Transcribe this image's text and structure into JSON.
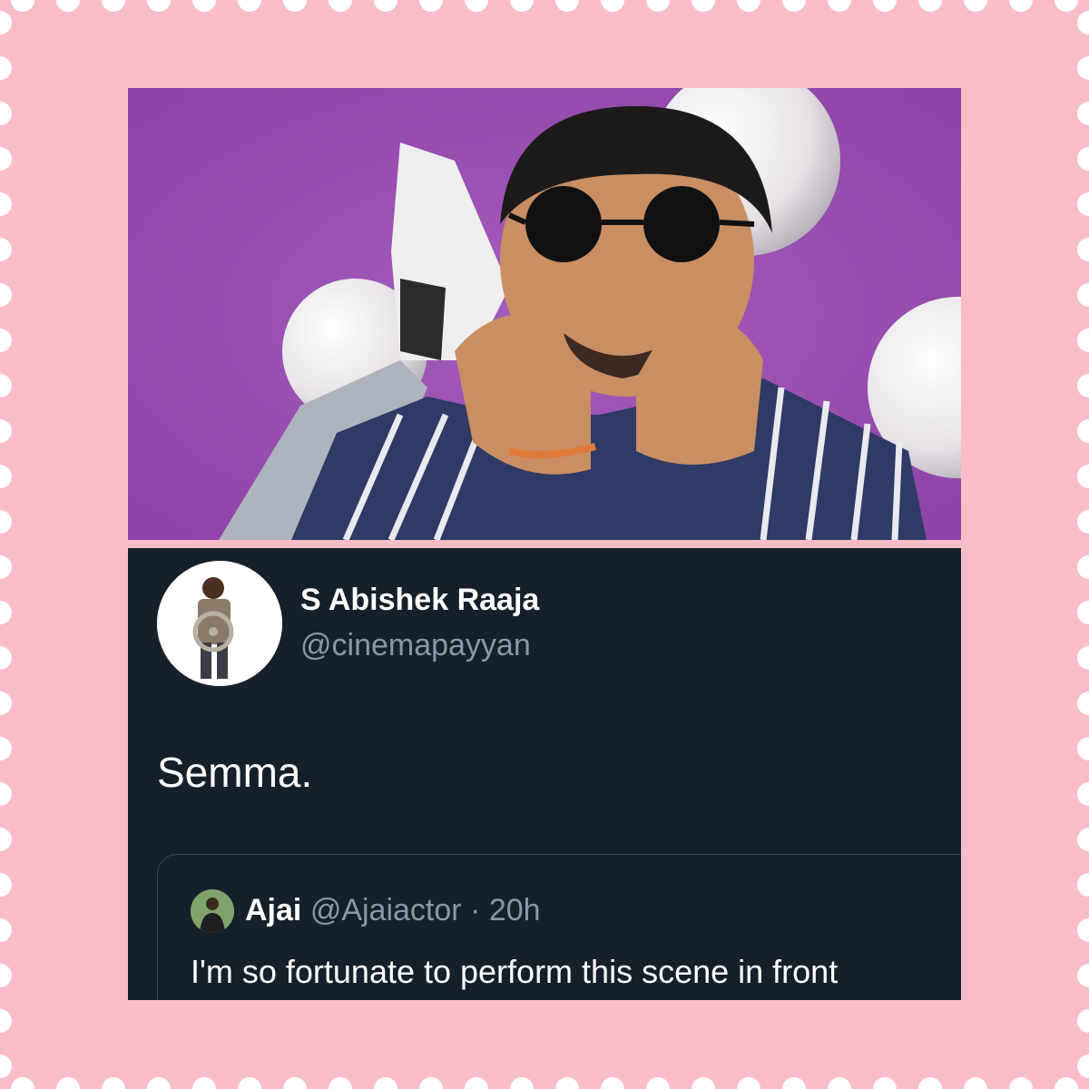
{
  "colors": {
    "frame": "#f9bdc7",
    "tweet_bg": "#15202b",
    "muted_text": "#8899a6",
    "photo_bg": "#9a4fb0"
  },
  "photo": {
    "icon": "portrait-photo"
  },
  "tweet": {
    "display_name": "S Abishek Raaja",
    "handle": "@cinemapayyan",
    "text": "Semma.",
    "quoted": {
      "name": "Ajai",
      "handle": "@Ajaiactor",
      "separator": "·",
      "time": "20h",
      "text": "I'm so fortunate to perform this scene in front"
    }
  }
}
